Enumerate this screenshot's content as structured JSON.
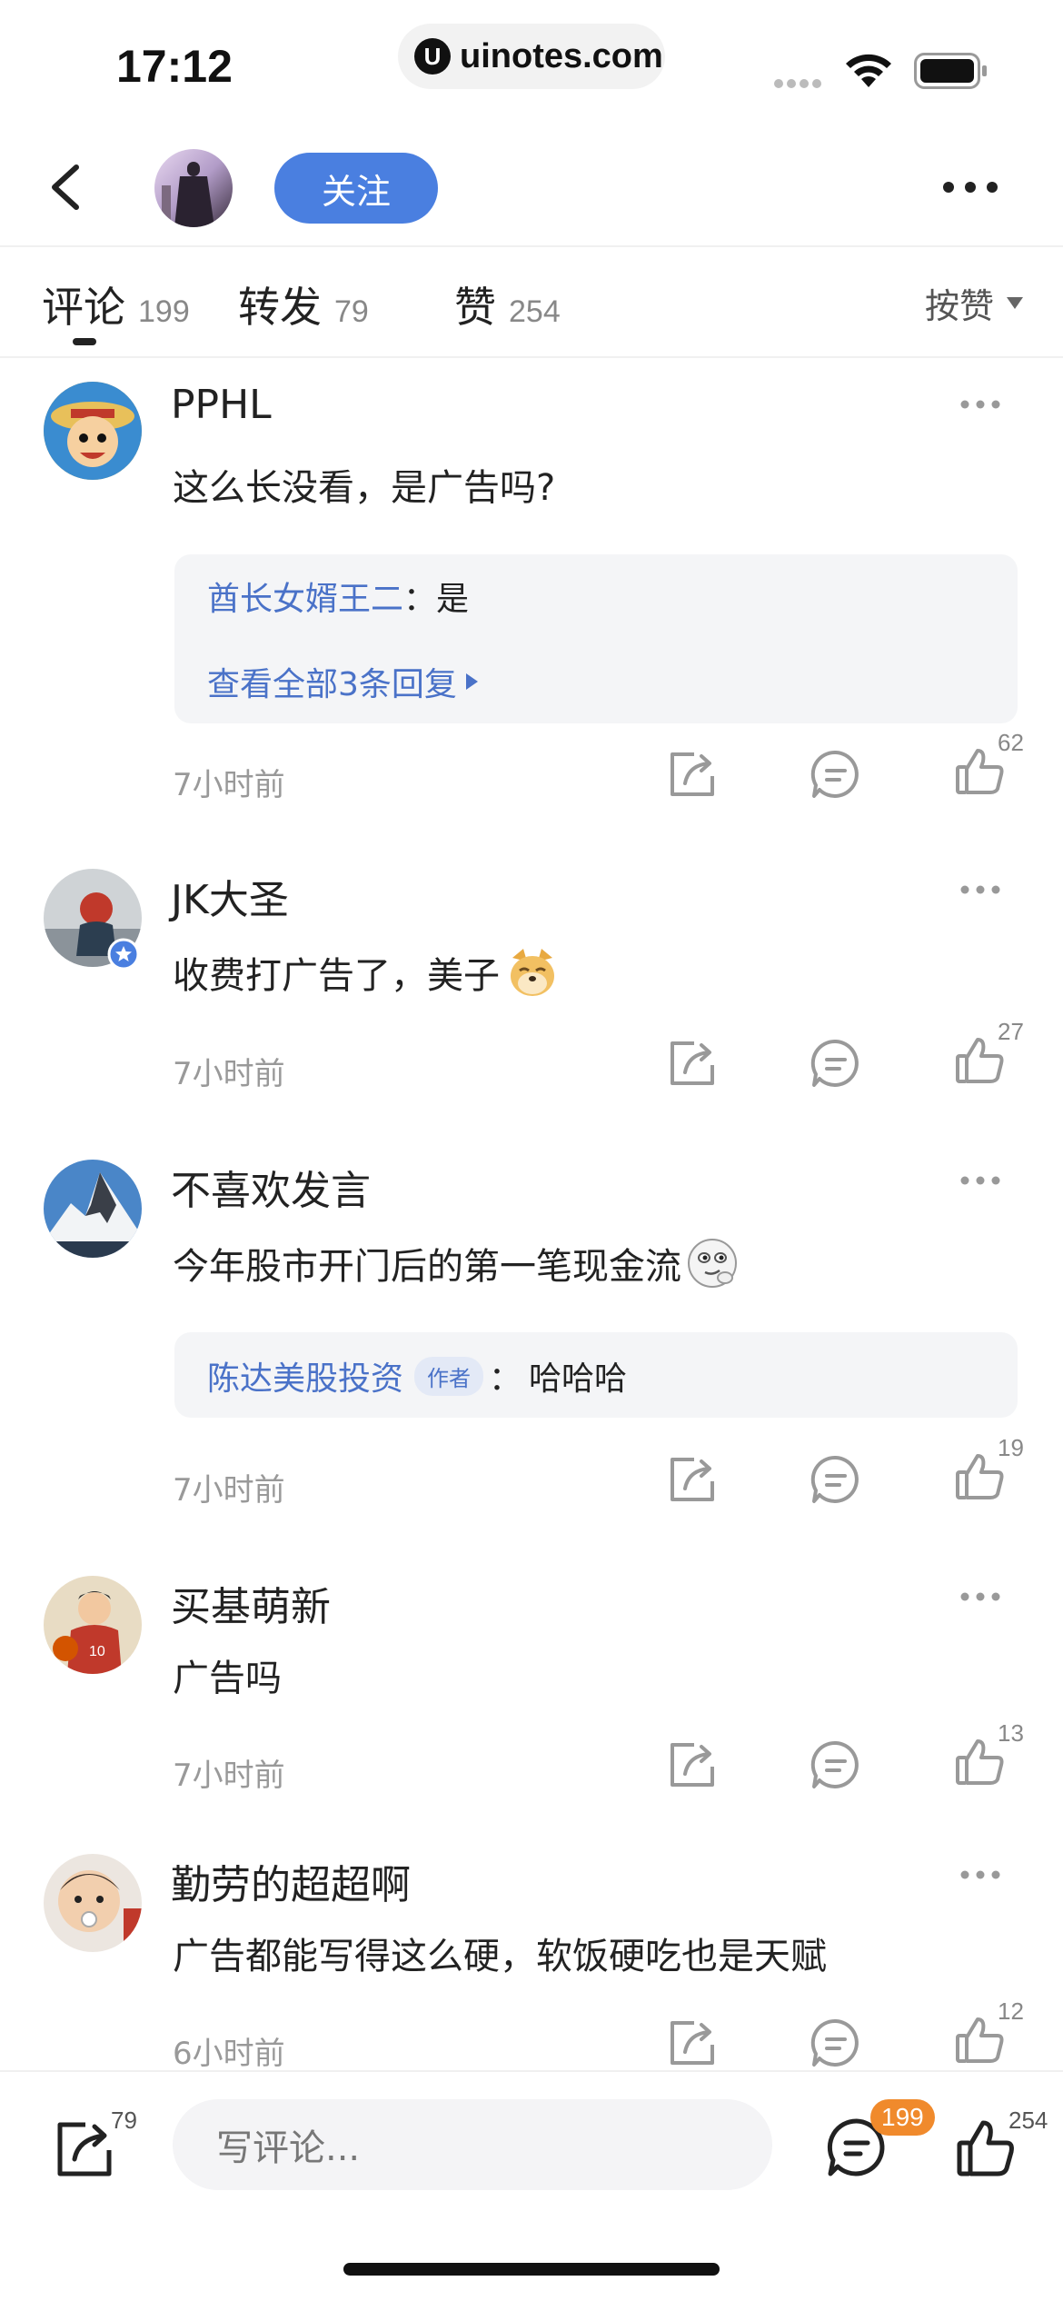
{
  "status_bar": {
    "time": "17:12",
    "url": "uinotes.com",
    "url_logo": "U",
    "icons": [
      "signal-icon",
      "wifi-icon",
      "battery-icon"
    ]
  },
  "nav": {
    "follow_label": "关注",
    "icons": [
      "back-icon",
      "more-icon"
    ]
  },
  "tabs": [
    {
      "label": "评论",
      "count": "199"
    },
    {
      "label": "转发",
      "count": "79"
    },
    {
      "label": "赞",
      "count": "254"
    }
  ],
  "sort": {
    "label": "按赞"
  },
  "comments": [
    {
      "name": "PPHL",
      "text": "这么长没看，是广告吗?",
      "reply": {
        "user": "酋长女婿王二",
        "sep": "：",
        "text": "是",
        "view_all": "查看全部3条回复"
      },
      "time": "7小时前",
      "likes": "62"
    },
    {
      "name": "JK大圣",
      "text": "收费打广告了，美子",
      "time": "7小时前",
      "likes": "27"
    },
    {
      "name": "不喜欢发言",
      "text": "今年股市开门后的第一笔现金流",
      "reply": {
        "user": "陈达美股投资",
        "tag": "作者",
        "sep": "：",
        "text": "哈哈哈"
      },
      "time": "7小时前",
      "likes": "19"
    },
    {
      "name": "买基萌新",
      "text": "广告吗",
      "time": "7小时前",
      "likes": "13"
    },
    {
      "name": "勤劳的超超啊",
      "text": "广告都能写得这么硬，软饭硬吃也是天赋",
      "time": "6小时前",
      "likes": "12"
    }
  ],
  "bottom_bar": {
    "share_count": "79",
    "input_placeholder": "写评论...",
    "comment_count": "199",
    "like_count": "254"
  },
  "colors": {
    "accent_blue": "#4a7fe0",
    "link_blue": "#4a72c8",
    "badge_orange": "#f08a2c"
  }
}
